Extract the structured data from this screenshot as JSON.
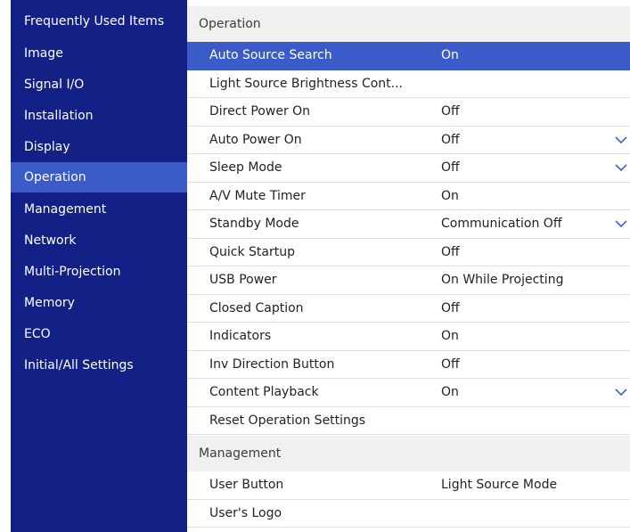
{
  "sidebar": {
    "items": [
      {
        "label": "Frequently Used Items",
        "selected": false
      },
      {
        "label": "Image",
        "selected": false
      },
      {
        "label": "Signal I/O",
        "selected": false
      },
      {
        "label": "Installation",
        "selected": false
      },
      {
        "label": "Display",
        "selected": false
      },
      {
        "label": "Operation",
        "selected": true
      },
      {
        "label": "Management",
        "selected": false
      },
      {
        "label": "Network",
        "selected": false
      },
      {
        "label": "Multi-Projection",
        "selected": false
      },
      {
        "label": "Memory",
        "selected": false
      },
      {
        "label": "ECO",
        "selected": false
      },
      {
        "label": "Initial/All Settings",
        "selected": false
      }
    ]
  },
  "operation": {
    "header": "Operation",
    "rows": [
      {
        "label": "Auto Source Search",
        "value": "On",
        "dropdown": false,
        "selected": true
      },
      {
        "label": "Light Source Brightness Cont...",
        "value": "",
        "dropdown": false,
        "selected": false
      },
      {
        "label": "Direct Power On",
        "value": "Off",
        "dropdown": false,
        "selected": false
      },
      {
        "label": "Auto Power On",
        "value": "Off",
        "dropdown": true,
        "selected": false
      },
      {
        "label": "Sleep Mode",
        "value": "Off",
        "dropdown": true,
        "selected": false
      },
      {
        "label": "A/V Mute Timer",
        "value": "On",
        "dropdown": false,
        "selected": false
      },
      {
        "label": "Standby Mode",
        "value": "Communication Off",
        "dropdown": true,
        "selected": false
      },
      {
        "label": "Quick Startup",
        "value": "Off",
        "dropdown": false,
        "selected": false
      },
      {
        "label": "USB Power",
        "value": "On While Projecting",
        "dropdown": false,
        "selected": false
      },
      {
        "label": "Closed Caption",
        "value": "Off",
        "dropdown": false,
        "selected": false
      },
      {
        "label": "Indicators",
        "value": "On",
        "dropdown": false,
        "selected": false
      },
      {
        "label": "Inv Direction Button",
        "value": "Off",
        "dropdown": false,
        "selected": false
      },
      {
        "label": "Content Playback",
        "value": "On",
        "dropdown": true,
        "selected": false
      },
      {
        "label": "Reset Operation Settings",
        "value": "",
        "dropdown": false,
        "selected": false
      }
    ]
  },
  "management": {
    "header": "Management",
    "rows": [
      {
        "label": "User Button",
        "value": "Light Source Mode",
        "dropdown": false,
        "selected": false
      },
      {
        "label": "User's Logo",
        "value": "",
        "dropdown": false,
        "selected": false
      }
    ]
  },
  "colors": {
    "sidebar_bg": "#132085",
    "selection": "#3b5bc9",
    "section_header_bg": "#f0f0f0"
  },
  "icons": {
    "dropdown": "chevron-down-icon"
  }
}
